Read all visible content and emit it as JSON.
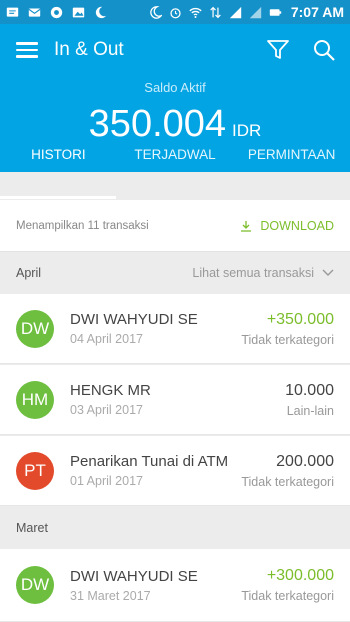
{
  "status_bar": {
    "time": "7:07 AM",
    "left_icons": [
      "message-icon",
      "mail-icon",
      "app-icon",
      "image-icon",
      "moon-icon"
    ],
    "right_icons": [
      "moon-icon",
      "alarm-icon",
      "wifi-icon",
      "data-arrows-icon",
      "signal-icon",
      "signal-icon",
      "battery-icon"
    ]
  },
  "app_bar": {
    "title": "In & Out",
    "filter_icon": "filter-icon",
    "search_icon": "search-icon"
  },
  "balance": {
    "label": "Saldo Aktif",
    "value": "350.004",
    "currency": "IDR"
  },
  "tabs": [
    {
      "label": "HISTORI",
      "active": true
    },
    {
      "label": "TERJADWAL",
      "active": false
    },
    {
      "label": "PERMINTAAN",
      "active": false
    }
  ],
  "summary": {
    "label": "Menampilkan  11  transaksi",
    "download_label": "DOWNLOAD"
  },
  "sections": [
    {
      "title": "April",
      "link_label": "Lihat semua transaksi",
      "transactions": [
        {
          "initials": "DW",
          "avatar_color": "#6ebf3f",
          "name": "DWI WAHYUDI SE",
          "date": "04 April 2017",
          "amount": "+350.000",
          "category": "Tidak terkategori",
          "positive": true
        },
        {
          "initials": "HM",
          "avatar_color": "#6ebf3f",
          "name": "HENGK MR",
          "date": "03 April 2017",
          "amount": "10.000",
          "category": "Lain-lain",
          "positive": false
        },
        {
          "initials": "PT",
          "avatar_color": "#e24a2b",
          "name": "Penarikan Tunai di ATM",
          "date": "01 April 2017",
          "amount": "200.000",
          "category": "Tidak terkategori",
          "positive": false
        }
      ]
    },
    {
      "title": "Maret",
      "link_label": "",
      "transactions": [
        {
          "initials": "DW",
          "avatar_color": "#6ebf3f",
          "name": "DWI WAHYUDI SE",
          "date": "31 Maret 2017",
          "amount": "+300.000",
          "category": "Tidak terkategori",
          "positive": true
        }
      ]
    }
  ],
  "colors": {
    "status_bar": "#1591c9",
    "app_bar": "#03a4e3",
    "positive": "#7cbd2c"
  }
}
